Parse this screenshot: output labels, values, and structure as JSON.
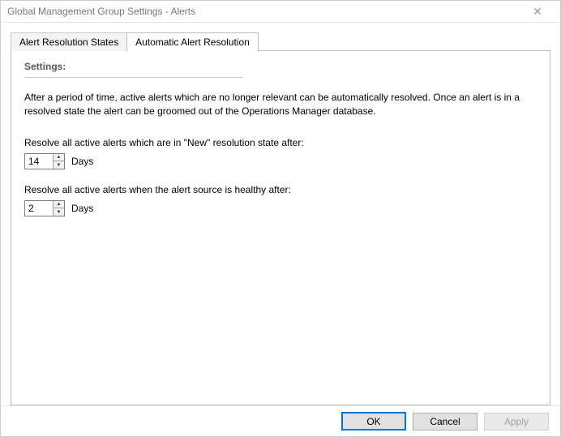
{
  "window": {
    "title": "Global Management Group Settings - Alerts"
  },
  "tabs": {
    "resolution_states": "Alert Resolution States",
    "auto_resolution": "Automatic Alert Resolution"
  },
  "panel": {
    "settings_header": "Settings:",
    "description": "After a period of time, active alerts which are no longer relevant can be automatically resolved. Once an alert is in a resolved state the alert can be groomed out of the Operations Manager database.",
    "field1_label": "Resolve all active alerts which are in \"New\" resolution state after:",
    "field1_value": "14",
    "field1_unit": "Days",
    "field2_label": "Resolve all active alerts when the alert source is healthy after:",
    "field2_value": "2",
    "field2_unit": "Days"
  },
  "buttons": {
    "ok": "OK",
    "cancel": "Cancel",
    "apply": "Apply"
  }
}
